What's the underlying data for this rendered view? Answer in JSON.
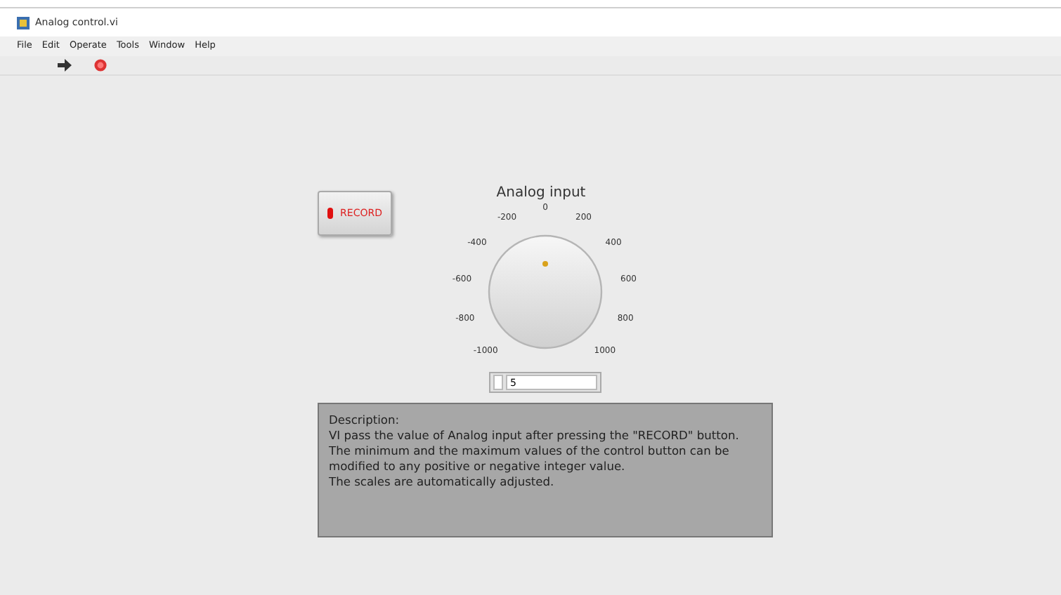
{
  "window": {
    "title": "Analog control.vi"
  },
  "menu": [
    "File",
    "Edit",
    "Operate",
    "Tools",
    "Window",
    "Help"
  ],
  "record_button": {
    "label": "RECORD"
  },
  "knob": {
    "label": "Analog input",
    "scale": [
      "-1000",
      "-800",
      "-600",
      "-400",
      "-200",
      "0",
      "200",
      "400",
      "600",
      "800",
      "1000"
    ],
    "value": "5"
  },
  "description": [
    "Description:",
    "VI pass the value of Analog input after pressing the \"RECORD\" button.",
    "The minimum and the maximum values of the control button can be",
    "modified to any positive or negative integer value.",
    "The scales are automatically adjusted."
  ]
}
